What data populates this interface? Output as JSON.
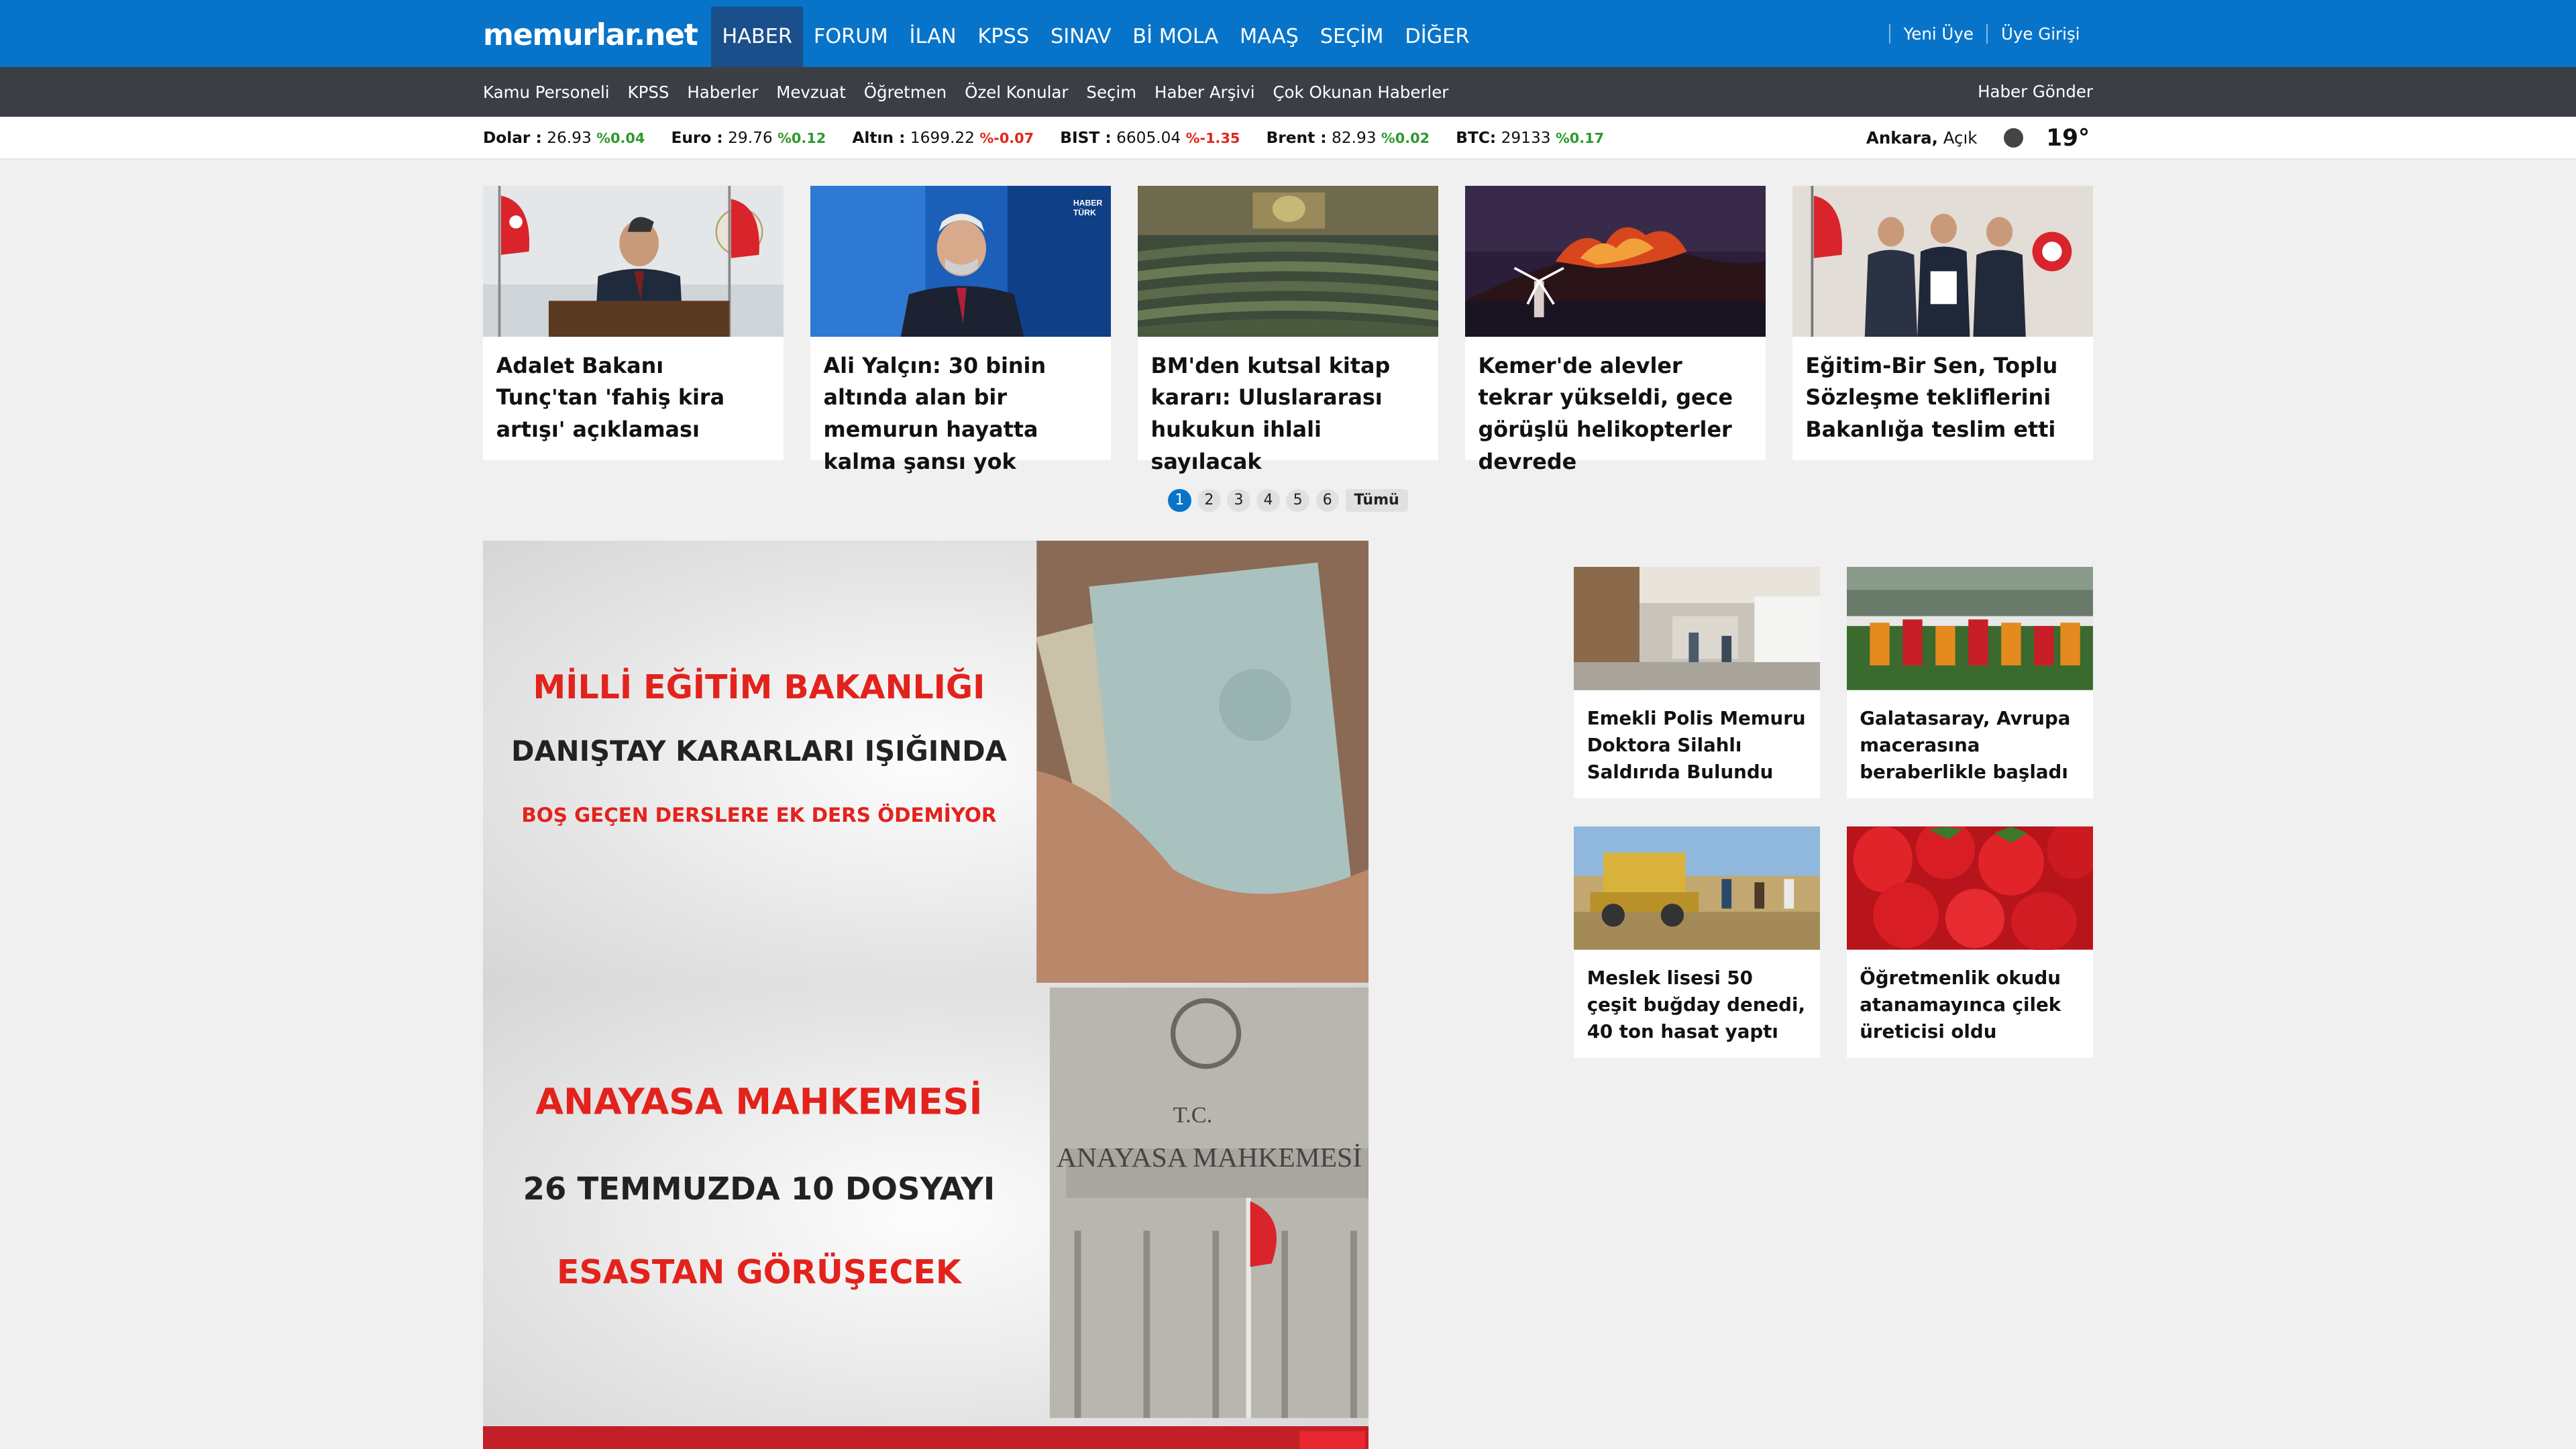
{
  "header": {
    "logo": "memurlar.net",
    "nav": [
      "HABER",
      "FORUM",
      "İLAN",
      "KPSS",
      "SINAV",
      "Bİ MOLA",
      "MAAŞ",
      "SEÇİM",
      "DİĞER"
    ],
    "user_links": [
      "Yeni Üye",
      "Üye Girişi"
    ]
  },
  "subnav": {
    "items": [
      "Kamu Personeli",
      "KPSS",
      "Haberler",
      "Mevzuat",
      "Öğretmen",
      "Özel Konular",
      "Seçim",
      "Haber Arşivi",
      "Çok Okunan Haberler"
    ],
    "send_news": "Haber Gönder"
  },
  "ticker": [
    {
      "label": "Dolar :",
      "value": "26.93",
      "change": "%0.04",
      "dir": "up"
    },
    {
      "label": "Euro :",
      "value": "29.76",
      "change": "%0.12",
      "dir": "up"
    },
    {
      "label": "Altın :",
      "value": "1699.22",
      "change": "%-0.07",
      "dir": "down"
    },
    {
      "label": "BIST :",
      "value": "6605.04",
      "change": "%-1.35",
      "dir": "down"
    },
    {
      "label": "Brent :",
      "value": "82.93",
      "change": "%0.02",
      "dir": "up"
    },
    {
      "label": "BTC:",
      "value": "29133",
      "change": "%0.17",
      "dir": "up"
    }
  ],
  "weather": {
    "city": "Ankara,",
    "condition": "Açık",
    "temp": "19°"
  },
  "top_news": [
    {
      "title": "Adalet Bakanı Tunç'tan 'fahiş kira artışı' açıklaması",
      "icon": "minister-office-photo"
    },
    {
      "title": "Ali Yalçın: 30 binin altında alan bir memurun hayatta kalma şansı yok",
      "icon": "tv-interview-photo",
      "badge": "HABER TÜRK"
    },
    {
      "title": "BM'den kutsal kitap kararı: Uluslararası hukukun ihlali sayılacak",
      "icon": "un-assembly-photo"
    },
    {
      "title": "Kemer'de alevler tekrar yükseldi, gece görüşlü helikopterler devrede",
      "icon": "forest-fire-photo"
    },
    {
      "title": "Eğitim-Bir Sen, Toplu Sözleşme tekliflerini Bakanlığa teslim etti",
      "icon": "handover-photo"
    }
  ],
  "pager": {
    "pages": [
      "1",
      "2",
      "3",
      "4",
      "5",
      "6"
    ],
    "all": "Tümü"
  },
  "hero": {
    "panel1": {
      "line1": "MİLLİ EĞİTİM BAKANLIĞI",
      "line2": "DANIŞTAY KARARLARI IŞIĞINDA",
      "line3": "BOŞ GEÇEN DERSLERE EK DERS ÖDEMİYOR"
    },
    "panel2": {
      "line1": "ANAYASA MAHKEMESİ",
      "line2": "26 TEMMUZDA 10 DOSYAYI",
      "line3": "ESASTAN GÖRÜŞECEK",
      "sign1": "T.C.",
      "sign2": "ANAYASA MAHKEMESİ"
    }
  },
  "side_news": [
    {
      "title": "Emekli Polis Memuru Doktora Silahlı Saldırıda Bulundu",
      "icon": "hospital-photo"
    },
    {
      "title": "Galatasaray, Avrupa macerasına beraberlikle başladı",
      "icon": "football-team-photo"
    },
    {
      "title": "Meslek lisesi 50 çeşit buğday denedi, 40 ton hasat yaptı",
      "icon": "harvest-photo"
    },
    {
      "title": "Öğretmenlik okudu atanamayınca çilek üreticisi oldu",
      "icon": "strawberries-photo"
    }
  ]
}
